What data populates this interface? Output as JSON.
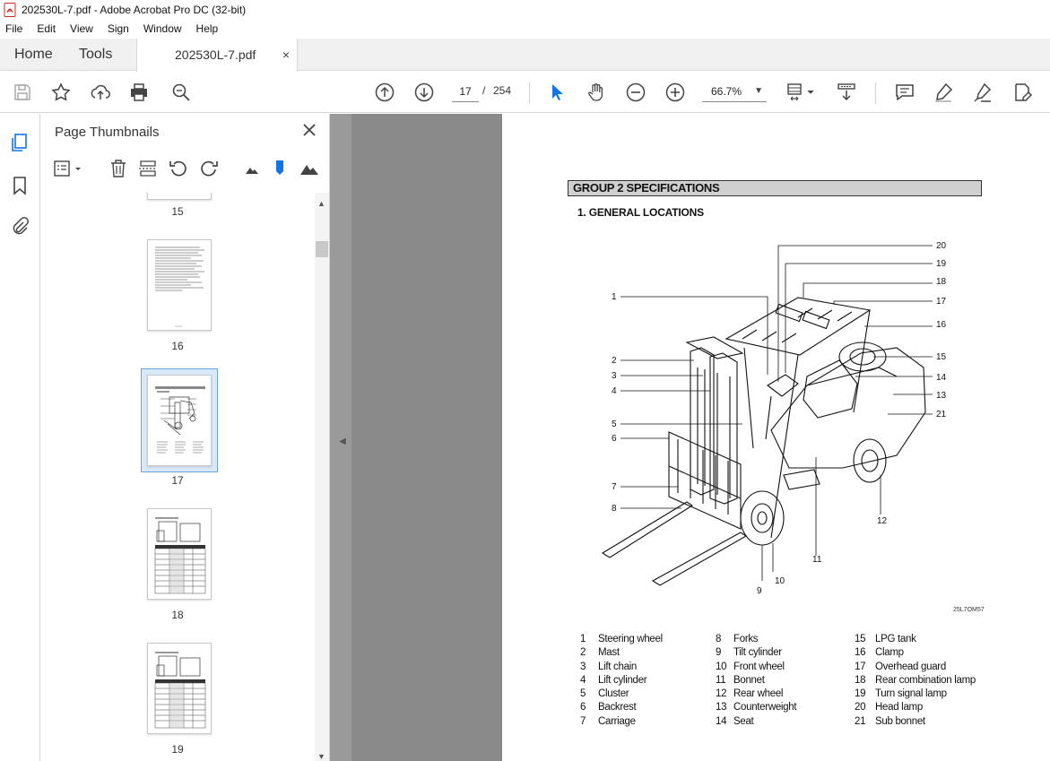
{
  "window": {
    "title": "202530L-7.pdf - Adobe Acrobat Pro DC (32-bit)"
  },
  "menu": [
    "File",
    "Edit",
    "View",
    "Sign",
    "Window",
    "Help"
  ],
  "tabs": {
    "home": "Home",
    "tools": "Tools",
    "document": "202530L-7.pdf",
    "close": "×"
  },
  "toolbar": {
    "current_page": "17",
    "separator": "/",
    "total_pages": "254",
    "zoom": "66.7%"
  },
  "thumbnails": {
    "title": "Page Thumbnails",
    "pages": [
      {
        "label": "15"
      },
      {
        "label": "16"
      },
      {
        "label": "17",
        "selected": true
      },
      {
        "label": "18"
      },
      {
        "label": "19"
      }
    ]
  },
  "document": {
    "group_heading": "GROUP 2 SPECIFICATIONS",
    "section_heading": "1. GENERAL LOCATIONS",
    "figure_code": "25L7OM57",
    "callouts": [
      "1",
      "2",
      "3",
      "4",
      "5",
      "6",
      "7",
      "8",
      "9",
      "10",
      "11",
      "12",
      "13",
      "14",
      "15",
      "16",
      "17",
      "18",
      "19",
      "20",
      "21"
    ],
    "legend": [
      [
        {
          "num": "1",
          "name": "Steering wheel"
        },
        {
          "num": "2",
          "name": "Mast"
        },
        {
          "num": "3",
          "name": "Lift chain"
        },
        {
          "num": "4",
          "name": "Lift cylinder"
        },
        {
          "num": "5",
          "name": "Cluster"
        },
        {
          "num": "6",
          "name": "Backrest"
        },
        {
          "num": "7",
          "name": "Carriage"
        }
      ],
      [
        {
          "num": "8",
          "name": "Forks"
        },
        {
          "num": "9",
          "name": "Tilt cylinder"
        },
        {
          "num": "10",
          "name": "Front wheel"
        },
        {
          "num": "11",
          "name": "Bonnet"
        },
        {
          "num": "12",
          "name": "Rear wheel"
        },
        {
          "num": "13",
          "name": "Counterweight"
        },
        {
          "num": "14",
          "name": "Seat"
        }
      ],
      [
        {
          "num": "15",
          "name": "LPG tank"
        },
        {
          "num": "16",
          "name": "Clamp"
        },
        {
          "num": "17",
          "name": "Overhead guard"
        },
        {
          "num": "18",
          "name": "Rear combination lamp"
        },
        {
          "num": "19",
          "name": "Turn signal lamp"
        },
        {
          "num": "20",
          "name": "Head lamp"
        },
        {
          "num": "21",
          "name": "Sub bonnet"
        }
      ]
    ]
  },
  "colors": {
    "acrobat_red": "#d9261c",
    "accent_blue": "#1473e6",
    "doc_background": "#9a9a9a",
    "heading_fill": "#d0d0d0"
  }
}
